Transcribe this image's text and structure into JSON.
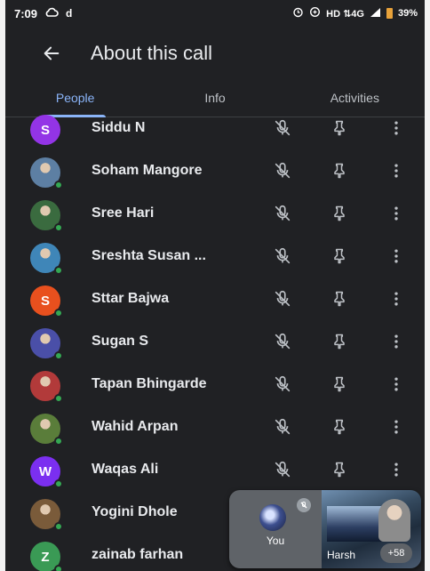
{
  "status_bar": {
    "time": "7:09",
    "left_glyphs": [
      "cloud-icon",
      "d-app-icon"
    ],
    "network": "HD ⇅4G",
    "battery": "39%"
  },
  "app_bar": {
    "title": "About this call",
    "back_icon": "arrow-left-icon"
  },
  "tabs": [
    {
      "label": "People",
      "active": true
    },
    {
      "label": "Info",
      "active": false
    },
    {
      "label": "Activities",
      "active": false
    }
  ],
  "people": [
    {
      "name": "Siddu N",
      "avatar_letter": "S",
      "avatar_color": "#9334e6",
      "online": false
    },
    {
      "name": "Soham Mangore",
      "avatar_letter": "",
      "avatar_color": "#5d7fa3",
      "online": true
    },
    {
      "name": "Sree Hari",
      "avatar_letter": "",
      "avatar_color": "#3a6b3f",
      "online": true
    },
    {
      "name": "Sreshta Susan ...",
      "avatar_letter": "",
      "avatar_color": "#3f86b8",
      "online": true
    },
    {
      "name": "Sttar Bajwa",
      "avatar_letter": "S",
      "avatar_color": "#e8501e",
      "online": true
    },
    {
      "name": "Sugan S",
      "avatar_letter": "",
      "avatar_color": "#4a4fa8",
      "online": true
    },
    {
      "name": "Tapan Bhingarde",
      "avatar_letter": "",
      "avatar_color": "#b23a3a",
      "online": true
    },
    {
      "name": "Wahid Arpan",
      "avatar_letter": "",
      "avatar_color": "#5a7d3a",
      "online": true
    },
    {
      "name": "Waqas Ali",
      "avatar_letter": "W",
      "avatar_color": "#7b2ff0",
      "online": true
    },
    {
      "name": "Yogini Dhole",
      "avatar_letter": "",
      "avatar_color": "#7a5b3a",
      "online": true
    },
    {
      "name": "zainab farhan",
      "avatar_letter": "Z",
      "avatar_color": "#3a9a55",
      "online": true
    }
  ],
  "row_actions": {
    "mic": "mic-off-icon",
    "pin": "pin-icon",
    "more": "more-vert-icon"
  },
  "pip": {
    "self_label": "You",
    "other_label": "Harsh",
    "more_count": "+58"
  },
  "colors": {
    "background": "#202124",
    "accent": "#8ab4f8",
    "online": "#34a853",
    "text": "#e8eaed"
  }
}
